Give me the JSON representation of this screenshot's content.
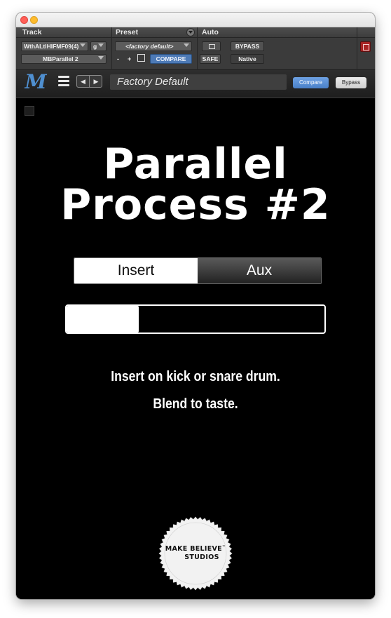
{
  "host": {
    "labels": {
      "track": "Track",
      "preset": "Preset",
      "auto": "Auto"
    },
    "track_name": "WthALtlHIFMF09(4)",
    "track_group": "g",
    "insert_name": "MBParallel 2",
    "preset_value": "<factory default>",
    "minus": "-",
    "plus": "+",
    "compare": "COMPARE",
    "safe": "SAFE",
    "bypass": "BYPASS",
    "native": "Native"
  },
  "plugin_bar": {
    "logo": "M",
    "prev": "◀",
    "next": "▶",
    "preset_name": "Factory Default",
    "compare": "Compare",
    "bypass": "Bypass"
  },
  "plugin": {
    "title_line1": "Parallel",
    "title_line2": "Process #2",
    "mode_options": [
      "Insert",
      "Aux"
    ],
    "mode_selected": "Insert",
    "blend_level_fraction": 0.28,
    "description_line1": "Insert on kick or snare drum.",
    "description_line2": "Blend to taste.",
    "brand_line1": "MAKE BELIEVE",
    "brand_tm": "™",
    "brand_line2": "STUDIOS"
  },
  "colors": {
    "accent_blue": "#4d7ab6",
    "compare_blue": "#5b8fd6",
    "record_red": "#a82424",
    "logo_blue": "#4f8fd0"
  }
}
